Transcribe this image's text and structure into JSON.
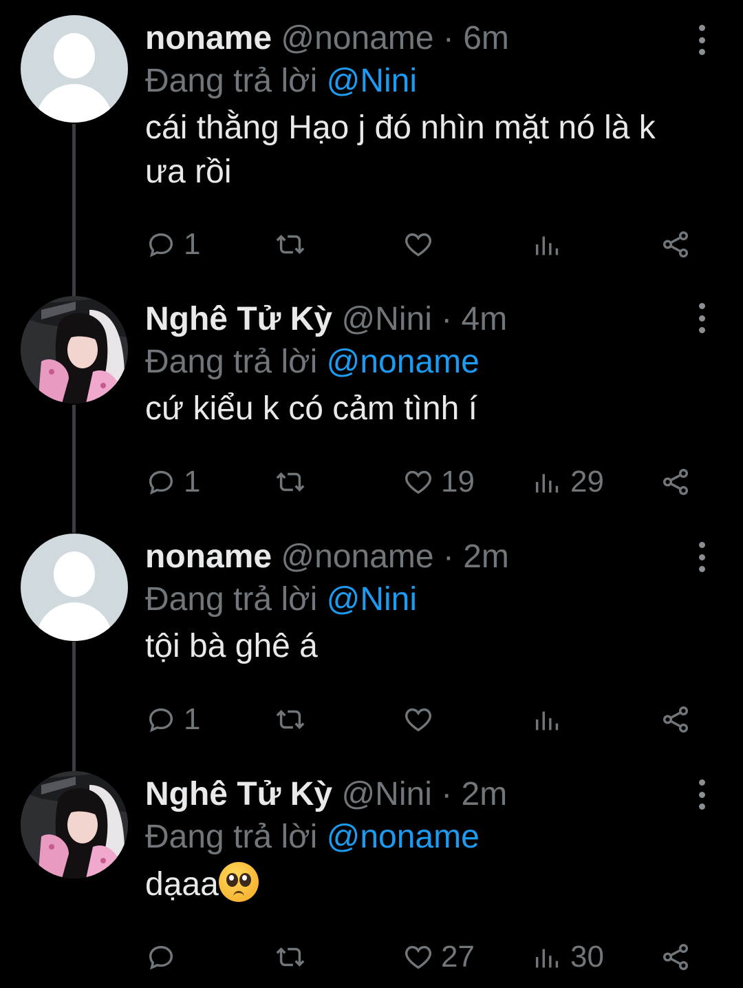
{
  "tweets": [
    {
      "name": "noname",
      "handle": "@noname",
      "separator": "·",
      "time": "6m",
      "reply_prefix": "Đang trả lời",
      "reply_to": "@Nini",
      "text": "cái thằng Hạo j đó nhìn mặt nó là k ưa rồi",
      "avatar": "default-avatar",
      "replies": "1",
      "retweets": "",
      "likes": "",
      "views": ""
    },
    {
      "name": "Nghê Tử Kỳ",
      "handle": "@Nini",
      "separator": "·",
      "time": "4m",
      "reply_prefix": "Đang trả lời",
      "reply_to": "@noname",
      "text": "cứ kiểu k có cảm tình í",
      "avatar": "photo-avatar",
      "replies": "1",
      "retweets": "",
      "likes": "19",
      "views": "29"
    },
    {
      "name": "noname",
      "handle": "@noname",
      "separator": "·",
      "time": "2m",
      "reply_prefix": "Đang trả lời",
      "reply_to": "@Nini",
      "text": "tội bà ghê á",
      "avatar": "default-avatar",
      "replies": "1",
      "retweets": "",
      "likes": "",
      "views": ""
    },
    {
      "name": "Nghê Tử Kỳ",
      "handle": "@Nini",
      "separator": "·",
      "time": "2m",
      "reply_prefix": "Đang trả lời",
      "reply_to": "@noname",
      "text": "dạaa",
      "text_emoji": "pleading-face-emoji",
      "avatar": "photo-avatar",
      "replies": "",
      "retweets": "",
      "likes": "27",
      "views": "30"
    }
  ],
  "icons": {
    "reply": "speech-bubble-icon",
    "retweet": "retweet-arrows-icon",
    "like": "heart-icon",
    "views": "bar-chart-icon",
    "share": "share-icon",
    "more": "vertical-dots-icon"
  },
  "colors": {
    "background": "#000000",
    "text": "#e7e9ea",
    "muted": "#71767b",
    "link": "#1d9bf0",
    "thread_line": "#3a3d41"
  }
}
